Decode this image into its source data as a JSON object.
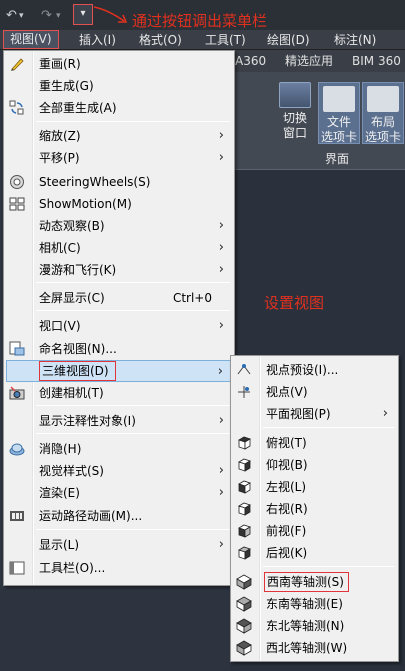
{
  "qat": {
    "undo_glyph": "↶",
    "redo_glyph": "↷",
    "dropdown_glyph": "▾"
  },
  "annotations": {
    "top_note": "通过按钮调出菜单栏",
    "view_note": "设置视图",
    "color": "#e0311f"
  },
  "menubar": {
    "items": [
      "视图(V)",
      "插入(I)",
      "格式(O)",
      "工具(T)",
      "绘图(D)",
      "标注(N)"
    ]
  },
  "ribbon": {
    "tabs": [
      "A360",
      "精选应用",
      "BIM 360"
    ],
    "buttons": [
      "切换\n窗口",
      "文件\n选项卡",
      "布局\n选项卡"
    ],
    "group_label": "界面"
  },
  "view_menu": {
    "items": [
      {
        "label": "重画(R)",
        "icon": "pencil-icon",
        "arrow": false
      },
      {
        "label": "重生成(G)",
        "icon": "",
        "arrow": false
      },
      {
        "label": "全部重生成(A)",
        "icon": "regen-all-icon",
        "arrow": false
      },
      {
        "label": "缩放(Z)",
        "icon": "",
        "arrow": true
      },
      {
        "label": "平移(P)",
        "icon": "",
        "arrow": true
      },
      {
        "label": "SteeringWheels(S)",
        "icon": "steering-wheel-icon",
        "arrow": false
      },
      {
        "label": "ShowMotion(M)",
        "icon": "show-motion-icon",
        "arrow": false
      },
      {
        "label": "动态观察(B)",
        "icon": "",
        "arrow": true
      },
      {
        "label": "相机(C)",
        "icon": "",
        "arrow": true
      },
      {
        "label": "漫游和飞行(K)",
        "icon": "",
        "arrow": true
      },
      {
        "label": "全屏显示(C)",
        "shortcut": "Ctrl+0",
        "icon": "",
        "arrow": false
      },
      {
        "label": "视口(V)",
        "icon": "",
        "arrow": true
      },
      {
        "label": "命名视图(N)...",
        "icon": "named-view-icon",
        "arrow": false
      },
      {
        "label": "三维视图(D)",
        "icon": "",
        "arrow": true,
        "selected": true
      },
      {
        "label": "创建相机(T)",
        "icon": "camera-icon",
        "arrow": false
      },
      {
        "label": "显示注释性对象(I)",
        "icon": "",
        "arrow": true
      },
      {
        "label": "消隐(H)",
        "icon": "hide-icon",
        "arrow": false
      },
      {
        "label": "视觉样式(S)",
        "icon": "",
        "arrow": true
      },
      {
        "label": "渲染(E)",
        "icon": "",
        "arrow": true
      },
      {
        "label": "运动路径动画(M)...",
        "icon": "film-icon",
        "arrow": false
      },
      {
        "label": "显示(L)",
        "icon": "",
        "arrow": true
      },
      {
        "label": "工具栏(O)...",
        "icon": "toolbar-icon",
        "arrow": false
      }
    ]
  },
  "sub_menu": {
    "items": [
      {
        "label": "视点预设(I)...",
        "icon": "viewpoint-preset-icon",
        "arrow": false
      },
      {
        "label": "视点(V)",
        "icon": "viewpoint-icon",
        "arrow": false
      },
      {
        "label": "平面视图(P)",
        "icon": "",
        "arrow": true
      },
      {
        "label": "俯视(T)",
        "icon": "cube-top-icon",
        "arrow": false
      },
      {
        "label": "仰视(B)",
        "icon": "cube-bottom-icon",
        "arrow": false
      },
      {
        "label": "左视(L)",
        "icon": "cube-left-icon",
        "arrow": false
      },
      {
        "label": "右视(R)",
        "icon": "cube-right-icon",
        "arrow": false
      },
      {
        "label": "前视(F)",
        "icon": "cube-front-icon",
        "arrow": false
      },
      {
        "label": "后视(K)",
        "icon": "cube-back-icon",
        "arrow": false
      },
      {
        "label": "西南等轴测(S)",
        "icon": "iso-sw-icon",
        "arrow": false,
        "highlight": true
      },
      {
        "label": "东南等轴测(E)",
        "icon": "iso-se-icon",
        "arrow": false
      },
      {
        "label": "东北等轴测(N)",
        "icon": "iso-ne-icon",
        "arrow": false
      },
      {
        "label": "西北等轴测(W)",
        "icon": "iso-nw-icon",
        "arrow": false
      }
    ]
  },
  "arrow_glyph": "›"
}
